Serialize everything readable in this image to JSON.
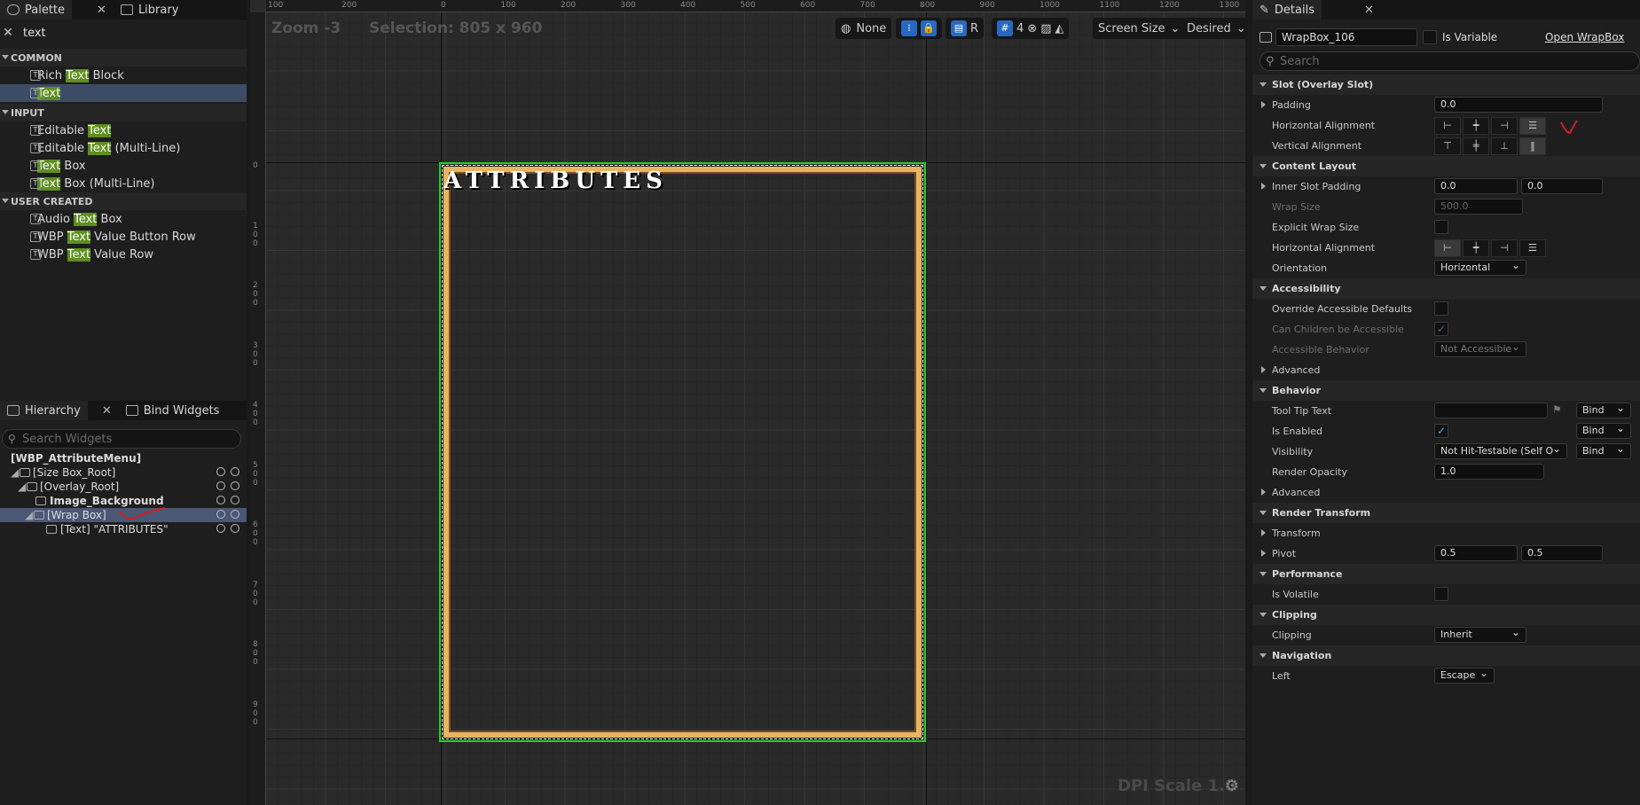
{
  "palette": {
    "tab": "Palette",
    "library_tab": "Library",
    "search": "text",
    "common": "COMMON",
    "input": "INPUT",
    "user": "USER CREATED",
    "common_items": [
      {
        "pre": "Rich ",
        "hl": "Text",
        "post": " Block"
      },
      {
        "pre": "",
        "hl": "Text",
        "post": ""
      }
    ],
    "input_items": [
      {
        "pre": "Editable ",
        "hl": "Text",
        "post": ""
      },
      {
        "pre": "Editable ",
        "hl": "Text",
        "post": " (Multi-Line)"
      },
      {
        "pre": "",
        "hl": "Text",
        "post": " Box"
      },
      {
        "pre": "",
        "hl": "Text",
        "post": " Box (Multi-Line)"
      }
    ],
    "user_items": [
      {
        "pre": "Audio ",
        "hl": "Text",
        "post": " Box"
      },
      {
        "pre": "WBP ",
        "hl": "Text",
        "post": " Value Button Row"
      },
      {
        "pre": "WBP ",
        "hl": "Text",
        "post": " Value Row"
      }
    ]
  },
  "hierarchy": {
    "tab": "Hierarchy",
    "bind_tab": "Bind Widgets",
    "search_placeholder": "Search Widgets",
    "items": [
      "[WBP_AttributeMenu]",
      "[Size Box_Root]",
      "[Overlay_Root]",
      "Image_Background",
      "[Wrap Box]",
      "[Text] \"ATTRIBUTES\""
    ]
  },
  "viewport": {
    "zoom": "Zoom -3",
    "selection": "Selection: 805 x 960",
    "none": "None",
    "r": "R",
    "grid": "4",
    "screen_size": "Screen Size",
    "desired": "Desired",
    "dpi": "DPI Scale 1.0",
    "title": "ATTRIBUTES",
    "ruler_top": [
      "0",
      "100",
      "200",
      "300",
      "400",
      "500",
      "600",
      "700",
      "800",
      "900",
      "1000",
      "1100",
      "1200",
      "1300"
    ],
    "ruler_left": [
      "0",
      "100",
      "200",
      "300",
      "400",
      "500",
      "600",
      "700",
      "800",
      "900"
    ]
  },
  "details": {
    "tab": "Details",
    "name": "WrapBox_106",
    "is_variable": "Is Variable",
    "open": "Open WrapBox",
    "search_placeholder": "Search",
    "slot": "Slot (Overlay Slot)",
    "padding": "Padding",
    "padding_val": "0.0",
    "h_align": "Horizontal Alignment",
    "v_align": "Vertical Alignment",
    "content_layout": "Content Layout",
    "inner_slot_padding": "Inner Slot Padding",
    "isp_x": "0.0",
    "isp_y": "0.0",
    "wrap_size": "Wrap Size",
    "wrap_val": "500.0",
    "explicit_wrap": "Explicit Wrap Size",
    "h_align2": "Horizontal Alignment",
    "orientation": "Orientation",
    "orientation_val": "Horizontal",
    "accessibility": "Accessibility",
    "override_acc": "Override Accessible Defaults",
    "can_children": "Can Children be Accessible",
    "acc_behavior": "Accessible Behavior",
    "acc_behavior_val": "Not Accessible",
    "advanced": "Advanced",
    "behavior": "Behavior",
    "tooltip": "Tool Tip Text",
    "bind": "Bind",
    "is_enabled": "Is Enabled",
    "visibility": "Visibility",
    "visibility_val": "Not Hit-Testable (Self O",
    "render_opacity": "Render Opacity",
    "render_opacity_val": "1.0",
    "render_transform": "Render Transform",
    "transform": "Transform",
    "pivot": "Pivot",
    "pivot_x": "0.5",
    "pivot_y": "0.5",
    "performance": "Performance",
    "is_volatile": "Is Volatile",
    "clipping_sec": "Clipping",
    "clipping": "Clipping",
    "clipping_val": "Inherit",
    "navigation": "Navigation",
    "left": "Left",
    "left_val": "Escape"
  }
}
